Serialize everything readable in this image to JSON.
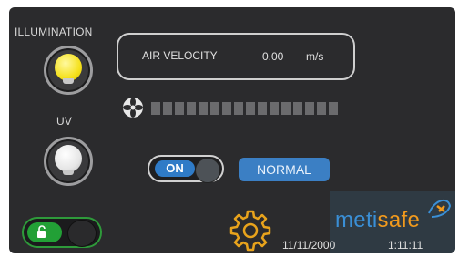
{
  "illumination": {
    "label": "ILLUMINATION",
    "icon": "bulb-yellow-icon"
  },
  "uv": {
    "label": "UV",
    "icon": "bulb-white-icon"
  },
  "air_velocity": {
    "label": "AIR VELOCITY",
    "value": "0.00",
    "unit": "m/s"
  },
  "fan": {
    "icon": "fan-icon",
    "level": 0
  },
  "power_toggle": {
    "label": "ON"
  },
  "status": {
    "label": "NORMAL"
  },
  "lock": {
    "icon": "unlock-icon"
  },
  "settings": {
    "icon": "gear-icon"
  },
  "brand": {
    "part1": "meti",
    "part2": "safe"
  },
  "footer": {
    "date": "11/11/2000",
    "time": "1:11:11"
  },
  "colors": {
    "accent_blue": "#3b7fc4",
    "brand_blue": "#3a8fd6",
    "brand_orange": "#f29a1d",
    "lock_green": "#22a036",
    "bulb_yellow": "#f5e11d"
  }
}
